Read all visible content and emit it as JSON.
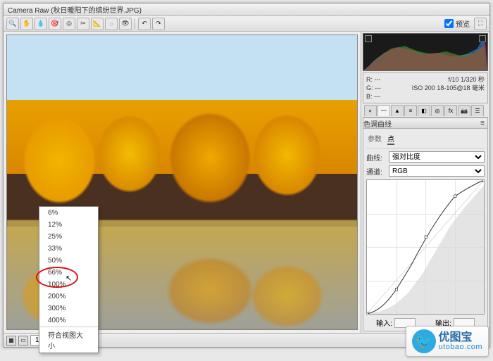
{
  "window": {
    "title": "Camera Raw (秋日暖阳下的缤纷世界.JPG)"
  },
  "toolbar": {
    "preview_label": "预览"
  },
  "exif": {
    "r": "R: ---",
    "g": "G: ---",
    "b": "B: ---",
    "aperture_shutter": "f/10  1/320 秒",
    "iso_lens": "ISO 200   18-105@18 毫米"
  },
  "panel": {
    "title": "色调曲线",
    "mode_parametric": "参数",
    "mode_point": "点",
    "curve_label": "曲线:",
    "curve_value": "强对比度",
    "channel_label": "通道:",
    "channel_value": "RGB",
    "input_label": "输入:",
    "output_label": "输出:"
  },
  "zoom_menu": {
    "items": [
      "6%",
      "12%",
      "25%",
      "33%",
      "50%",
      "66%",
      "100%",
      "200%",
      "300%",
      "400%"
    ],
    "fit": "符合视图大小"
  },
  "status": {
    "zoom": "100%"
  },
  "watermark": {
    "cn": "优图宝",
    "en": "utobao.com"
  },
  "chart_data": {
    "type": "line",
    "title": "色调曲线",
    "xlabel": "输入",
    "ylabel": "输出",
    "xlim": [
      0,
      255
    ],
    "ylim": [
      0,
      255
    ],
    "series": [
      {
        "name": "RGB",
        "values": [
          [
            0,
            0
          ],
          [
            32,
            18
          ],
          [
            64,
            46
          ],
          [
            96,
            92
          ],
          [
            128,
            146
          ],
          [
            160,
            192
          ],
          [
            192,
            224
          ],
          [
            224,
            244
          ],
          [
            255,
            255
          ]
        ]
      }
    ],
    "control_points": [
      [
        0,
        0
      ],
      [
        64,
        46
      ],
      [
        128,
        146
      ],
      [
        192,
        224
      ],
      [
        255,
        255
      ]
    ]
  }
}
